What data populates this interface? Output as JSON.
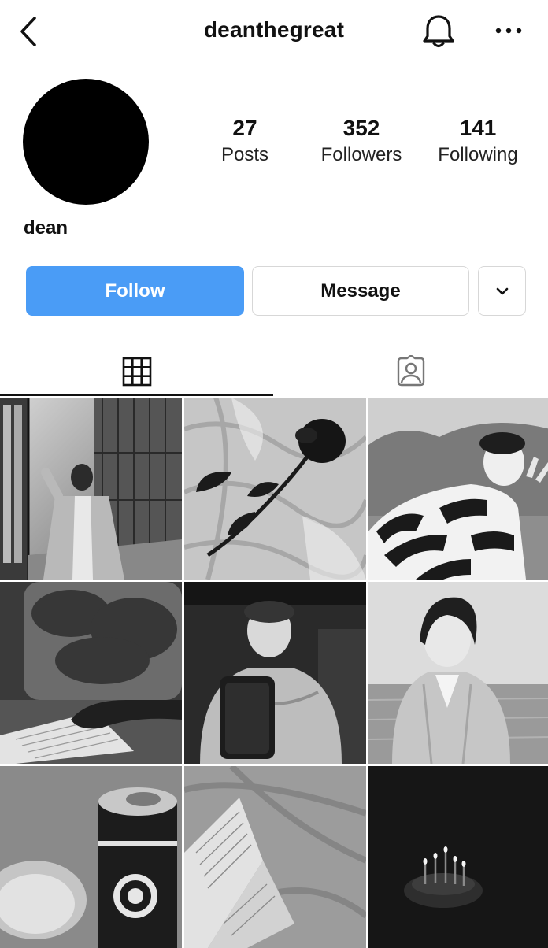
{
  "header": {
    "username": "deanthegreat",
    "icons": {
      "back": "chevron-left-icon",
      "notifications": "bell-icon",
      "more": "more-horizontal-icon"
    }
  },
  "profile": {
    "name": "dean",
    "stats": [
      {
        "value": "27",
        "label": "Posts"
      },
      {
        "value": "352",
        "label": "Followers"
      },
      {
        "value": "141",
        "label": "Following"
      }
    ]
  },
  "actions": {
    "follow_label": "Follow",
    "message_label": "Message",
    "dropdown_icon": "chevron-down-icon"
  },
  "tabs": [
    {
      "icon": "grid-icon",
      "active": true
    },
    {
      "icon": "tagged-person-icon",
      "active": false
    }
  ],
  "posts": [
    {
      "subject": "man in coat on balcony"
    },
    {
      "subject": "black rose on sheets"
    },
    {
      "subject": "man in striped sweater"
    },
    {
      "subject": "notebook by train window"
    },
    {
      "subject": "mirror selfie in jacket"
    },
    {
      "subject": "man by the sea"
    },
    {
      "subject": "espresso can and glass"
    },
    {
      "subject": "open book on bed"
    },
    {
      "subject": "candles in the dark"
    }
  ],
  "colors": {
    "accent": "#4a9cf6",
    "border": "#d7d7d7",
    "text": "#111111"
  }
}
